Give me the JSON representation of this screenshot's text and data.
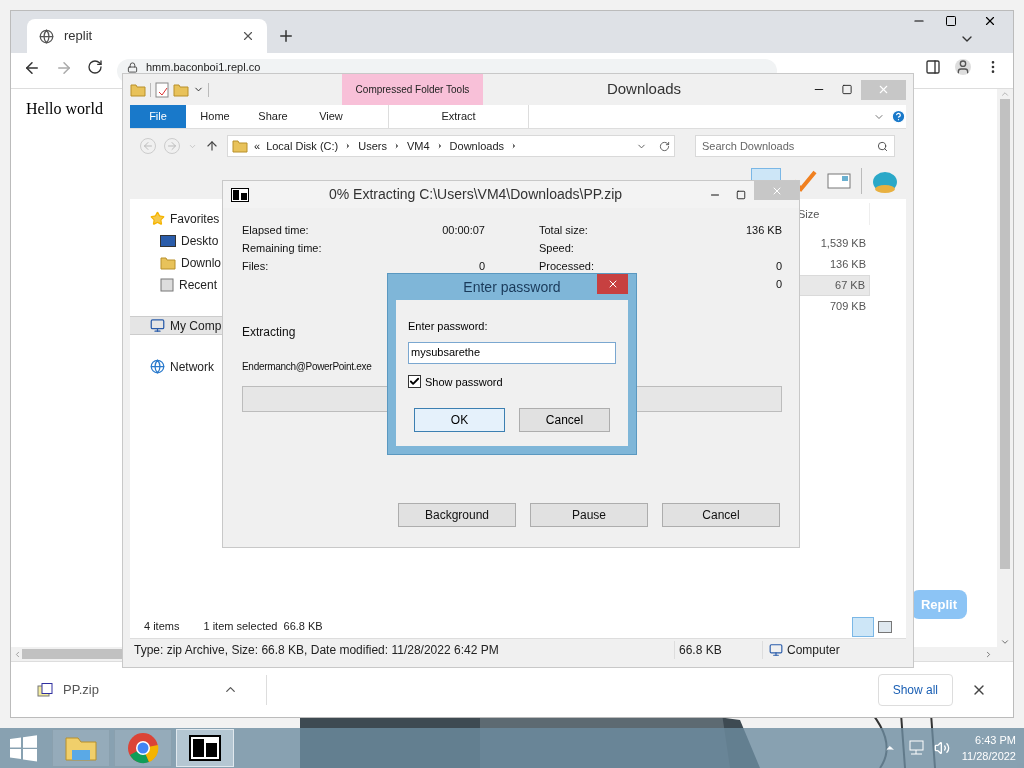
{
  "chrome": {
    "tab": {
      "title": "replit"
    },
    "url": "hmm.baconboi1.repl.co",
    "page": {
      "heading": "Hello world",
      "button": "Replit"
    },
    "downloads": {
      "file": "PP.zip",
      "show_all": "Show all"
    }
  },
  "explorer": {
    "title": "Downloads",
    "contextual_header": "Compressed Folder Tools",
    "ribbon_tabs": [
      {
        "label": "File",
        "kind": "file"
      },
      {
        "label": "Home",
        "kind": "tab"
      },
      {
        "label": "Share",
        "kind": "tab"
      },
      {
        "label": "View",
        "kind": "tab"
      },
      {
        "label": "Extract",
        "kind": "contextual"
      }
    ],
    "breadcrumb": [
      "«",
      "Local Disk (C:)",
      "Users",
      "VM4",
      "Downloads"
    ],
    "search": {
      "placeholder": "Search Downloads"
    },
    "nav": [
      {
        "label": "Favorites",
        "kind": "favorites",
        "selected": false
      },
      {
        "label": "Deskto",
        "kind": "desktop",
        "selected": false
      },
      {
        "label": "Downlo",
        "kind": "downloads",
        "selected": false
      },
      {
        "label": "Recent",
        "kind": "recent",
        "selected": false
      },
      {
        "label": "My Comp",
        "kind": "computer",
        "selected": true
      },
      {
        "label": "Network",
        "kind": "network",
        "selected": false
      }
    ],
    "columns": [
      "Size"
    ],
    "rows": [
      {
        "size": "1,539 KB",
        "selected": false
      },
      {
        "size": "136 KB",
        "selected": false
      },
      {
        "size": "67 KB",
        "selected": true
      },
      {
        "size": "709 KB",
        "selected": false
      }
    ],
    "status": {
      "count": "4 items",
      "selection": "1 item selected  66.8 KB"
    },
    "details": {
      "info": "Type: zip Archive, Size: 66.8 KB, Date modified: 11/28/2022 6:42 PM",
      "size": "66.8 KB",
      "location": "Computer"
    }
  },
  "extract": {
    "title": "0% Extracting C:\\Users\\VM4\\Downloads\\PP.zip",
    "left_stats": [
      {
        "label": "Elapsed time:",
        "value": "00:00:07"
      },
      {
        "label": "Remaining time:"
      },
      {
        "label": "Files:",
        "value": "0"
      }
    ],
    "right_stats": [
      {
        "label": "Total size:",
        "value": "136 KB"
      },
      {
        "label": "Speed:"
      },
      {
        "label": "Processed:",
        "value": "0"
      },
      {
        "value": "0"
      }
    ],
    "status": "Extracting",
    "file": "Endermanch@PowerPoint.exe",
    "progress": {
      "level": 0
    },
    "buttons": [
      "Background",
      "Pause",
      "Cancel"
    ]
  },
  "password": {
    "title": "Enter password",
    "label": "Enter password:",
    "value": "mysubsarethe",
    "show_password": {
      "label": "Show password",
      "checked": true
    },
    "buttons": [
      {
        "label": "OK",
        "default": true
      },
      {
        "label": "Cancel",
        "default": false
      }
    ]
  },
  "taskbar": {
    "apps": [
      {
        "kind": "explorer",
        "selected": false
      },
      {
        "kind": "chrome",
        "selected": false
      },
      {
        "kind": "sevenzip",
        "selected": true
      }
    ],
    "time": "6:43 PM",
    "date": "11/28/2022"
  }
}
